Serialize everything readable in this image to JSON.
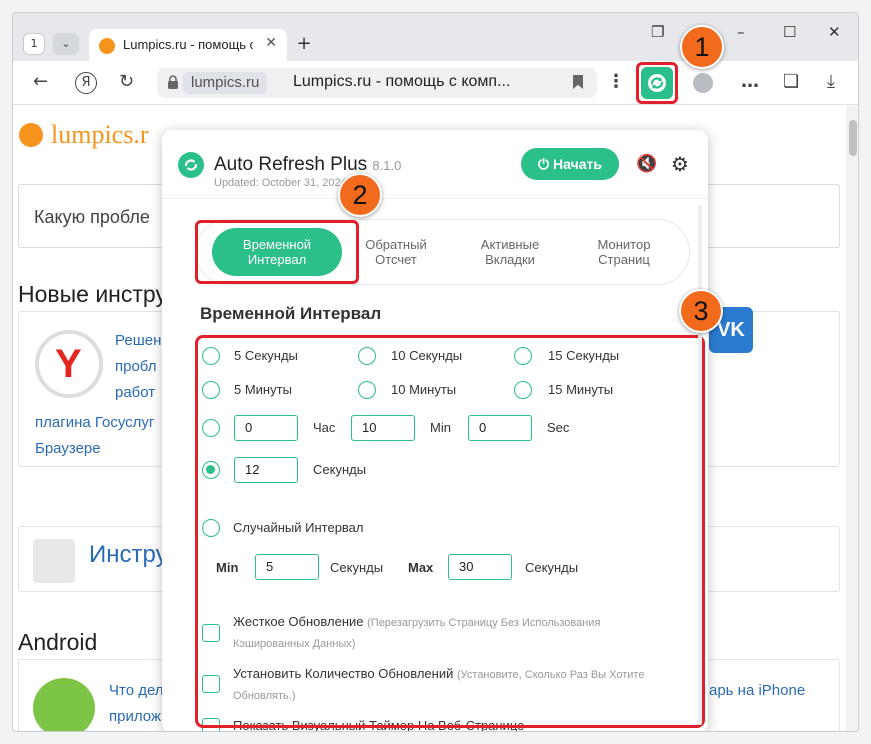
{
  "browser": {
    "tab_count": "1",
    "tab_title": "Lumpics.ru - помощь с",
    "domain": "lumpics.ru",
    "page_title": "Lumpics.ru - помощь с комп..."
  },
  "page": {
    "logo_text": "lumpics.r",
    "search_placeholder": "Какую пробле",
    "section1": "Новые инстру",
    "article1_lines": [
      "Решен",
      "пробл",
      "работ",
      "плагина Госуслуг",
      "Браузере"
    ],
    "section2_link": "Инстру",
    "section3": "Android",
    "article2_lines": [
      "Что дел",
      "прилож"
    ],
    "iphone_link": "арь на iPhone",
    "vk_label": "VK"
  },
  "popup": {
    "title": "Auto Refresh Plus",
    "version": "8.1.0",
    "updated": "Updated: October 31, 2024",
    "start_label": "Начать",
    "tabs": [
      {
        "label_line1": "Временной",
        "label_line2": "Интервал"
      },
      {
        "label_line1": "Обратный",
        "label_line2": "Отсчет"
      },
      {
        "label_line1": "Активные",
        "label_line2": "Вкладки"
      },
      {
        "label_line1": "Монитор",
        "label_line2": "Страниц"
      }
    ],
    "section_heading": "Временной Интервал",
    "presets": [
      "5 Секунды",
      "10 Секунды",
      "15 Секунды",
      "5 Минуты",
      "10 Минуты",
      "15 Минуты"
    ],
    "custom_time": {
      "hours": "0",
      "hours_label": "Час",
      "minutes": "10",
      "minutes_label": "Min",
      "seconds": "0",
      "seconds_label": "Sec"
    },
    "seconds_option": {
      "value": "12",
      "label": "Секунды",
      "selected": true
    },
    "random": {
      "label": "Случайный Интервал",
      "min_label": "Min",
      "min_value": "5",
      "min_unit": "Секунды",
      "max_label": "Max",
      "max_value": "30",
      "max_unit": "Секунды"
    },
    "checkboxes": [
      {
        "label": "Жесткое Обновление",
        "hint": "(Перезагрузить Страницу Без Использования Кэшированных Данных)"
      },
      {
        "label": "Установить Количество Обновлений",
        "hint": "(Установите, Сколько Раз Вы Хотите Обновлять.)"
      },
      {
        "label": "Показать Визуальный Таймер На Веб-Странице",
        "hint": ""
      }
    ]
  },
  "annotations": [
    "1",
    "2",
    "3"
  ],
  "colors": {
    "accent": "#2bbf8a",
    "highlight": "#e0202a",
    "badge": "#f26b1d",
    "brand": "#f7941d"
  }
}
